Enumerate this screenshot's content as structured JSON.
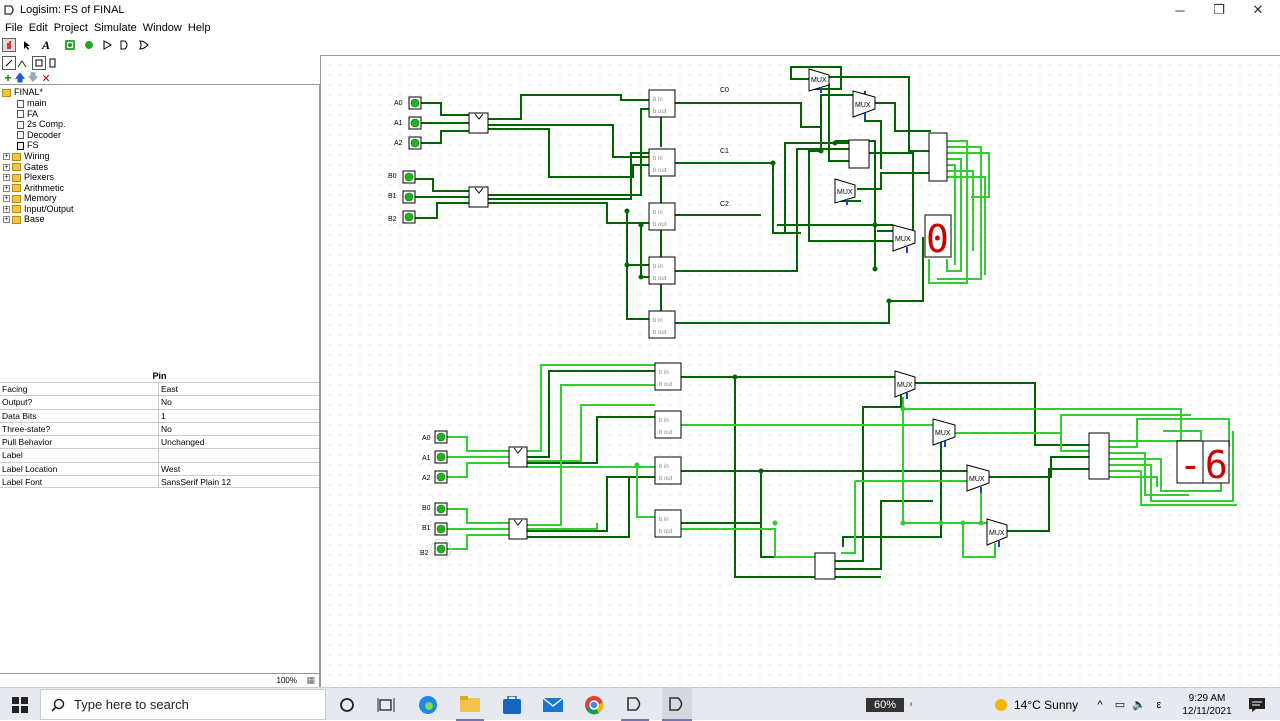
{
  "window": {
    "title": "Logisim: FS of FINAL"
  },
  "menu": [
    "File",
    "Edit",
    "Project",
    "Simulate",
    "Window",
    "Help"
  ],
  "explorer": {
    "project": "FINAL*",
    "circuits": [
      "main",
      "FA",
      "2s Comp.",
      "Decoder",
      "FS"
    ],
    "libraries": [
      "Wiring",
      "Gates",
      "Plexers",
      "Arithmetic",
      "Memory",
      "Input/Output",
      "Base"
    ]
  },
  "attributes": {
    "title": "Pin",
    "rows": [
      {
        "key": "Facing",
        "value": "East"
      },
      {
        "key": "Output?",
        "value": "No"
      },
      {
        "key": "Data Bits",
        "value": "1"
      },
      {
        "key": "Three-state?",
        "value": "No"
      },
      {
        "key": "Pull Behavior",
        "value": "Unchanged"
      },
      {
        "key": "Label",
        "value": ""
      },
      {
        "key": "Label Location",
        "value": "West"
      },
      {
        "key": "Label Font",
        "value": "SansSerif Plain 12"
      }
    ]
  },
  "zoom": "100%",
  "circuit": {
    "inputs_top": [
      "A0",
      "A1",
      "A2",
      "B0",
      "B1",
      "B2"
    ],
    "inputs_bottom": [
      "A0",
      "A1",
      "A2",
      "B0",
      "B1",
      "B2"
    ],
    "carry_labels": [
      "C0",
      "C1",
      "C2"
    ],
    "fs_label_top": "b in",
    "fs_label_bottom": "b out",
    "mux_label": "MUX",
    "display_top": "0",
    "display_bottom": "-6",
    "pin_value": "0",
    "colors": {
      "wire_dark": "#006400",
      "wire_light": "#32cd32",
      "segment": "#cc0000"
    }
  },
  "taskbar": {
    "search_placeholder": "Type here to search",
    "battery": "60%",
    "weather": "14°C  Sunny",
    "time": "9:29 AM",
    "date": "12/11/2021"
  }
}
